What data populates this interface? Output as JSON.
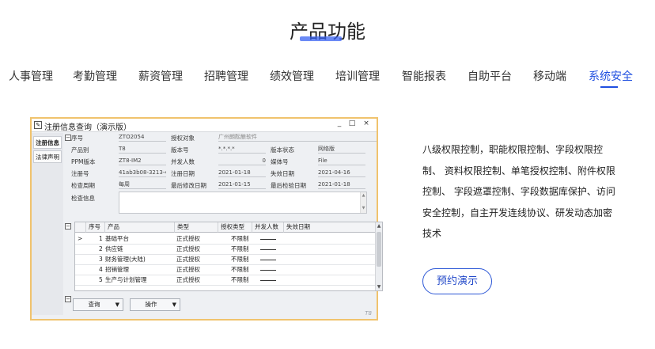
{
  "section_title": "产品功能",
  "nav_tabs": [
    "人事管理",
    "考勤管理",
    "薪资管理",
    "招聘管理",
    "绩效管理",
    "培训管理",
    "智能报表",
    "自助平台",
    "移动端",
    "系统安全"
  ],
  "active_tab": "系统安全",
  "window": {
    "title": "注册信息查询（演示版）",
    "controls": [
      "_",
      "□",
      "×"
    ],
    "side_tabs": [
      "注册信息",
      "法律声明"
    ],
    "fields": {
      "seq_label": "序号",
      "seq_value": "ZTO2054",
      "auth_obj_label": "授权对象",
      "auth_obj_value": "广州朗酝酿软件",
      "category_label": "产品别",
      "category_value": "T8",
      "version_label": "版本号",
      "version_value": "*.*.*.*",
      "version_status_label": "版本状态",
      "version_status_value": "网络版",
      "ppm_label": "PPM版本",
      "ppm_value": "ZT8-IM2",
      "concurrent_label": "并发人数",
      "concurrent_value": "0",
      "media_label": "媒体号",
      "media_value": "File",
      "reg_label": "注册号",
      "reg_value": "41ab3b08-3213-4",
      "reg_date_label": "注册日期",
      "reg_date_value": "2021-01-18",
      "expire_label": "失效日期",
      "expire_value": "2021-04-16",
      "check_period_label": "检查周期",
      "check_period_value": "每周",
      "last_modify_label": "最后修改日期",
      "last_modify_value": "2021-01-15",
      "last_check_label": "最后检验日期",
      "last_check_value": "2021-01-18",
      "check_info_label": "检查信息"
    },
    "grid": {
      "columns": [
        "序号",
        "产品",
        "类型",
        "授权类型",
        "并发人数",
        "失效日期"
      ],
      "rows": [
        {
          "no": "1",
          "product": "基础平台",
          "type": "正式授权",
          "auth": "不限制"
        },
        {
          "no": "2",
          "product": "供应链",
          "type": "正式授权",
          "auth": "不限制"
        },
        {
          "no": "3",
          "product": "财务管理(大陆)",
          "type": "正式授权",
          "auth": "不限制"
        },
        {
          "no": "4",
          "product": "招销管理",
          "type": "正式授权",
          "auth": "不限制"
        },
        {
          "no": "5",
          "product": "生产与计划管理",
          "type": "正式授权",
          "auth": "不限制"
        }
      ],
      "row_pointer": ">"
    },
    "buttons": {
      "query": "查询",
      "operate": "操作"
    },
    "badge": "T8"
  },
  "description": [
    "八级权限控制，职能权限控制、字段权限控",
    "制、 资料权限控制、单笔授权控制、附件权限",
    "控制、 字段遮罩控制、字段数据库保护、访问",
    "安全控制，自主开发连线协议、研发动态加密",
    "技术"
  ],
  "demo_button": "预约演示"
}
